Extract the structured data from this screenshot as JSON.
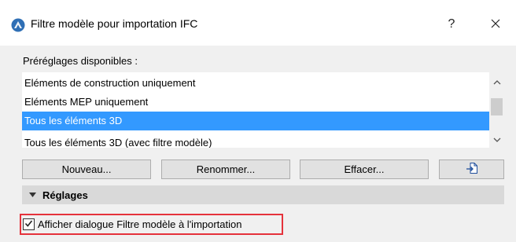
{
  "window": {
    "title": "Filtre modèle pour importation IFC",
    "help_label": "?"
  },
  "presets": {
    "label": "Préréglages disponibles :",
    "items": [
      {
        "label": "Eléments de construction uniquement",
        "selected": false
      },
      {
        "label": "Eléments MEP uniquement",
        "selected": false
      },
      {
        "label": "Tous les éléments 3D",
        "selected": true
      },
      {
        "label": "Tous les éléments 3D (avec filtre modèle)",
        "selected": false
      }
    ]
  },
  "buttons": {
    "new_label": "Nouveau...",
    "rename_label": "Renommer...",
    "delete_label": "Effacer..."
  },
  "settings": {
    "label": "Réglages",
    "expanded": true
  },
  "options": {
    "show_dialog_label": "Afficher dialogue Filtre modèle à l'importation",
    "show_dialog_checked": true
  },
  "colors": {
    "selection": "#3399ff",
    "highlight_border": "#e5323b",
    "app_icon": "#2f6fb5"
  },
  "icons": {
    "app": "archicad-app-icon",
    "close": "close-icon",
    "export": "export-icon",
    "settings_toggle": "triangle-down-icon"
  }
}
